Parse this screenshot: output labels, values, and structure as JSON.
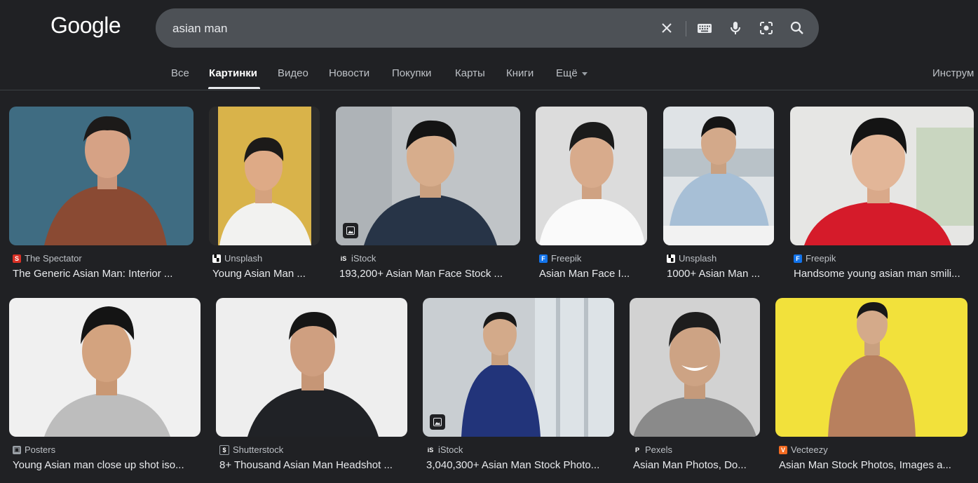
{
  "logo": "Google",
  "search": {
    "query": "asian man"
  },
  "tabs": [
    "Все",
    "Картинки",
    "Видео",
    "Новости",
    "Покупки",
    "Карты",
    "Книги",
    "Ещё"
  ],
  "tools_label": "Инструм",
  "results": [
    {
      "source": "The Spectator",
      "title": "The Generic Asian Man: Interior ...",
      "favicon_color": "#d93025",
      "favicon_text": "S"
    },
    {
      "source": "Unsplash",
      "title": "Young Asian Man ...",
      "favicon_color": "#ffffff",
      "favicon_text": "▚"
    },
    {
      "source": "iStock",
      "title": "193,200+ Asian Man Face Stock ...",
      "favicon_color": "#202124",
      "favicon_text": "iS"
    },
    {
      "source": "Freepik",
      "title": "Asian Man Face I...",
      "favicon_color": "#1273eb",
      "favicon_text": "F"
    },
    {
      "source": "Unsplash",
      "title": "1000+ Asian Man ...",
      "favicon_color": "#ffffff",
      "favicon_text": "▚"
    },
    {
      "source": "Freepik",
      "title": "Handsome young asian man smili...",
      "favicon_color": "#1273eb",
      "favicon_text": "F"
    },
    {
      "source": "Posters",
      "title": "Young Asian man close up shot iso...",
      "favicon_color": "#9aa0a6",
      "favicon_text": "▣"
    },
    {
      "source": "Shutterstock",
      "title": "8+ Thousand Asian Man Headshot ...",
      "favicon_color": "#202124",
      "favicon_text": "$"
    },
    {
      "source": "iStock",
      "title": "3,040,300+ Asian Man Stock Photo...",
      "favicon_color": "#202124",
      "favicon_text": "iS"
    },
    {
      "source": "Pexels",
      "title": "Asian Man Photos, Do...",
      "favicon_color": "#202124",
      "favicon_text": "P"
    },
    {
      "source": "Vecteezy",
      "title": "Asian Man Stock Photos, Images a...",
      "favicon_color": "#f36b21",
      "favicon_text": "V"
    }
  ],
  "colors": {
    "background": "#202124",
    "searchbar": "#4d5156",
    "text": "#e8eaed",
    "muted": "#bdc1c6"
  }
}
